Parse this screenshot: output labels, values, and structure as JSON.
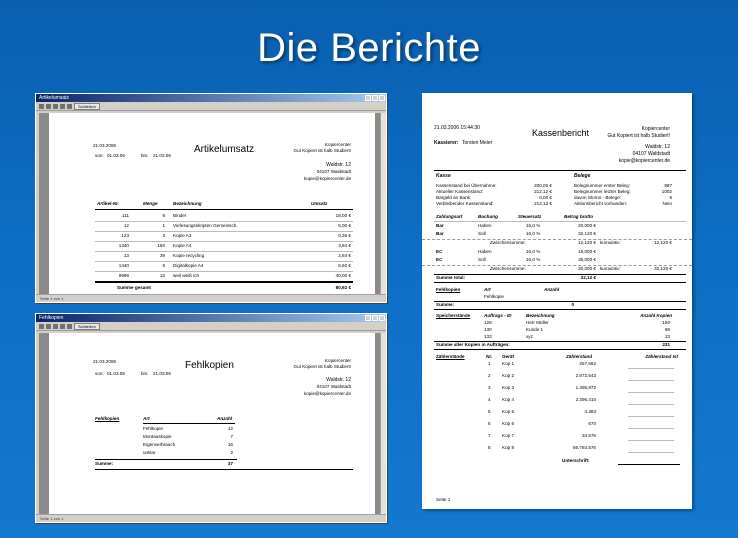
{
  "slide": {
    "title": "Die Berichte"
  },
  "artikel_window": {
    "title": "Artikelumsatz",
    "status": "Seite 1 von 1",
    "toolbar_btn": "Schließen",
    "date": "21.03.2006",
    "range_from_label": "von:",
    "range_from": "01.03.06",
    "range_to_label": "bis:",
    "range_to": "21.03.06",
    "company": [
      "Kopiercenter",
      "Gut Kopiert ist halb Studiert!"
    ],
    "address": [
      "Waldstr. 12",
      "04107 Waldstadt",
      "kopie@kopiercenter.de"
    ],
    "headers": [
      "Artikel-Nr.",
      "Menge",
      "Bezeichnung",
      "Umsatz"
    ],
    "rows": [
      [
        "111",
        "6",
        "Binder",
        "18,00 €"
      ],
      [
        "12",
        "1",
        "Vorlesungsskripten Gemeinsch.",
        "6,00 €"
      ],
      [
        "123",
        "3",
        "Kopie A3",
        "0,36 €"
      ],
      [
        "1340",
        "160",
        "Kopie A4",
        "3,84 €"
      ],
      [
        "13",
        "39",
        "Kopie recycling",
        "2,84 €"
      ],
      [
        "1440",
        "5",
        "Digitalkopie A4",
        "6,60 €"
      ],
      [
        "9999",
        "13",
        "weil weiß ich",
        "40,00 €"
      ]
    ],
    "total_label": "Summe gesamt",
    "total": "80,92 €"
  },
  "fehl_window": {
    "title": "Fehlkopien",
    "status": "Seite 1 von 1",
    "toolbar_btn": "Schließen",
    "date": "21.03.2006",
    "range_from_label": "von:",
    "range_from": "01.03.06",
    "range_to_label": "bis:",
    "range_to": "21.03.06",
    "company": [
      "Kopiercenter",
      "Gut Kopiert ist halb Studiert!"
    ],
    "address": [
      "Waldstr. 12",
      "04107 Waldstadt",
      "kopie@kopiercenter.de"
    ],
    "headers": [
      "Fehlkopien",
      "Art",
      "Anzahl"
    ],
    "rows": [
      [
        "Fehlkopie",
        "12"
      ],
      [
        "Montauskopie",
        "7"
      ],
      [
        "Eigenverbrauch",
        "16"
      ],
      [
        "unklar",
        "2"
      ]
    ],
    "sum_label": "Summe:",
    "sum": "37"
  },
  "kassen": {
    "datetime": "21.03.2006 15:44:30",
    "title": "Kassenbericht",
    "cashier_label": "Kassierer:",
    "cashier": "Torsten Meier",
    "company": [
      "Kopiercenter",
      "Gut Kopiert ist halb Studiert!"
    ],
    "address": [
      "Waldstr. 12",
      "04107 Waldstadt",
      "kopie@kopiercenter.de"
    ],
    "kasse_header": "Kasse",
    "kasse_rows": [
      [
        "Kassenstand bei Übernahme:",
        "200,00 €"
      ],
      [
        "Aktueller Kassenstand:",
        "212,12 €"
      ],
      [
        "Bargeld an Bank:",
        "0,00 €"
      ],
      [
        "Verbleibender Kassenstand:",
        "212,12 €"
      ]
    ],
    "belege_header": "Belege",
    "belege_rows": [
      [
        "Belegnummer erster Beleg:",
        "987"
      ],
      [
        "Belegnummer letzter Beleg:",
        "1002"
      ],
      [
        "davon Storno - Belege:",
        "5"
      ],
      [
        "Aktionsbericht vorhanden:",
        "Nein"
      ]
    ],
    "zahl_headers": [
      "Zahlungsart",
      "Buchung",
      "Steuersatz",
      "Betrag brutto"
    ],
    "zahl_rows": [
      [
        "Bar",
        "Haben",
        "16,0 %",
        "20,000 €",
        "",
        ""
      ],
      [
        "Bar",
        "Soll",
        "16,0 %",
        "32,120 €",
        "",
        ""
      ],
      [
        "",
        "Zwischensumme:",
        "",
        "12,120 €",
        "kumulativ:",
        "12,120 €"
      ],
      [
        "EC",
        "Haben",
        "16,0 %",
        "15,000 €",
        "",
        ""
      ],
      [
        "EC",
        "Soll",
        "16,0 %",
        "35,000 €",
        "",
        ""
      ],
      [
        "",
        "Zwischensumme:",
        "",
        "20,000 €",
        "kumulativ:",
        "32,120 €"
      ]
    ],
    "summe_total_label": "Summe total:",
    "summe_total": "32,12 €",
    "fehl_headers": [
      "Fehlkopien",
      "Art",
      "Anzahl"
    ],
    "fehl_row": "Fehlkopie",
    "fehl_sum_label": "Summe:",
    "fehl_sum": "0",
    "speicher_headers": [
      "Speicherstände",
      "Auftrags - ID",
      "Bezeichnung",
      "Anzahl Kopien"
    ],
    "speicher_rows": [
      [
        "128",
        "Herr Müller",
        "150"
      ],
      [
        "130",
        "Kunde 1",
        "68"
      ],
      [
        "133",
        "xyz",
        "13"
      ]
    ],
    "speicher_sum_label": "Summe aller Kopien in Aufträgen:",
    "speicher_sum": "231",
    "zaehler_headers": [
      "Zählerstände",
      "Nr.",
      "Gerät",
      "Zählerstand",
      "Zählerstand Ist"
    ],
    "zaehler_rows": [
      [
        "1",
        "Kop 1",
        "257,692"
      ],
      [
        "2",
        "Kop 2",
        "2.872,543"
      ],
      [
        "3",
        "Kop 3",
        "1.395,872"
      ],
      [
        "4",
        "Kop 4",
        "2.396,410"
      ],
      [
        "5",
        "Kop 5",
        "4.383"
      ],
      [
        "6",
        "Kop 6",
        "670"
      ],
      [
        "7",
        "Kop 7",
        "34.576"
      ],
      [
        "8",
        "Kop 8",
        "56.784,576"
      ]
    ],
    "signature_label": "Unterschrift:",
    "page": "Seite 1"
  }
}
